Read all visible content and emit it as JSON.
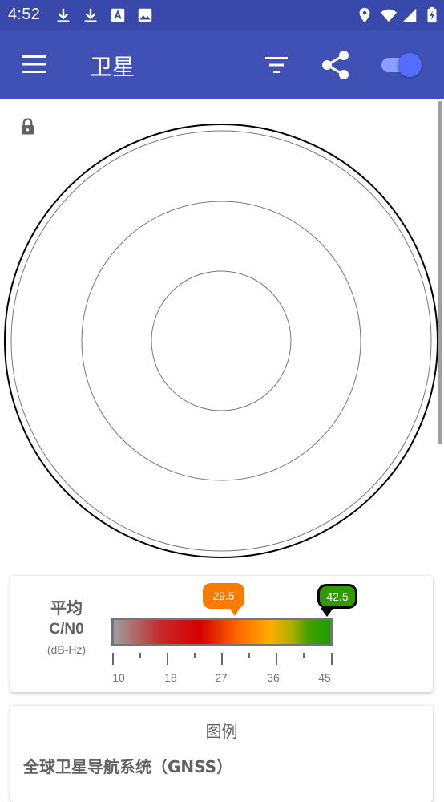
{
  "status_bar": {
    "time": "4:52",
    "left_icons": [
      "download-icon",
      "download-icon",
      "text-a-icon",
      "image-icon"
    ],
    "right_icons": [
      "location-icon",
      "wifi-icon",
      "signal-icon",
      "battery-icon"
    ]
  },
  "app_bar": {
    "title": "卫星",
    "menu_icon": "menu-icon",
    "filter_icon": "filter-icon",
    "share_icon": "share-icon",
    "toggle_on": true,
    "color": "#3f51b5",
    "status_color": "#3949ab"
  },
  "sky_plot": {
    "lock_icon": "lock-icon"
  },
  "cn0": {
    "label_top": "平均",
    "label_mid": "C/N0",
    "label_unit": "(dB-Hz)",
    "avg_value": "29.5",
    "max_value": "42.5",
    "avg_color": "#f57c00",
    "max_color": "#2e9b00",
    "tick_labels": [
      "10",
      "18",
      "27",
      "36",
      "45"
    ]
  },
  "legend": {
    "title": "图例",
    "section_gnss": "全球卫星导航系统（GNSS）"
  }
}
